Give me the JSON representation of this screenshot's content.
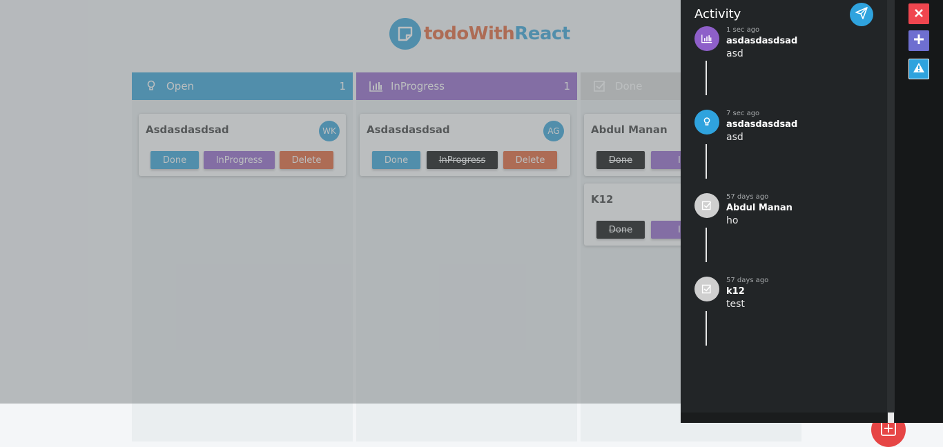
{
  "app": {
    "logo_part1": "todoWith",
    "logo_part2": "React"
  },
  "columns": {
    "open": {
      "title": "Open",
      "count": "1"
    },
    "inprogress": {
      "title": "InProgress",
      "count": "1"
    },
    "done": {
      "title": "Done"
    }
  },
  "cards": {
    "open_1": {
      "title": "Asdasdasdsad",
      "avatar": "WK",
      "done": "Done",
      "inprogress": "InProgress",
      "delete": "Delete"
    },
    "prog_1": {
      "title": "Asdasdasdsad",
      "avatar": "AG",
      "done": "Done",
      "inprogress": "InProgress",
      "delete": "Delete"
    },
    "done_1": {
      "title": "Abdul Manan",
      "done": "Done",
      "inprogress": "InPr"
    },
    "done_2": {
      "title": "K12",
      "done": "Done",
      "inprogress": "InPr"
    }
  },
  "activity": {
    "title": "Activity",
    "entries": [
      {
        "time": "1 sec ago",
        "name": "asdasdasdsad",
        "message": "asd",
        "icon": "bar-chart-icon",
        "color": "#8e5fc9"
      },
      {
        "time": "7 sec ago",
        "name": "asdasdasdsad",
        "message": "asd",
        "icon": "lightbulb-icon",
        "color": "#2fa3de"
      },
      {
        "time": "57 days ago",
        "name": "Abdul Manan",
        "message": "ho",
        "icon": "checkbox-icon",
        "color": "#cfcfcf"
      },
      {
        "time": "57 days ago",
        "name": "k12",
        "message": "test",
        "icon": "checkbox-icon",
        "color": "#cfcfcf"
      }
    ]
  },
  "colors": {
    "open": "#2b9fd6",
    "inprogress": "#8e5fc9",
    "delete": "#e25a2b",
    "done_header": "#d8d8d8",
    "close": "#f0464f",
    "add": "#6e6fd0"
  }
}
